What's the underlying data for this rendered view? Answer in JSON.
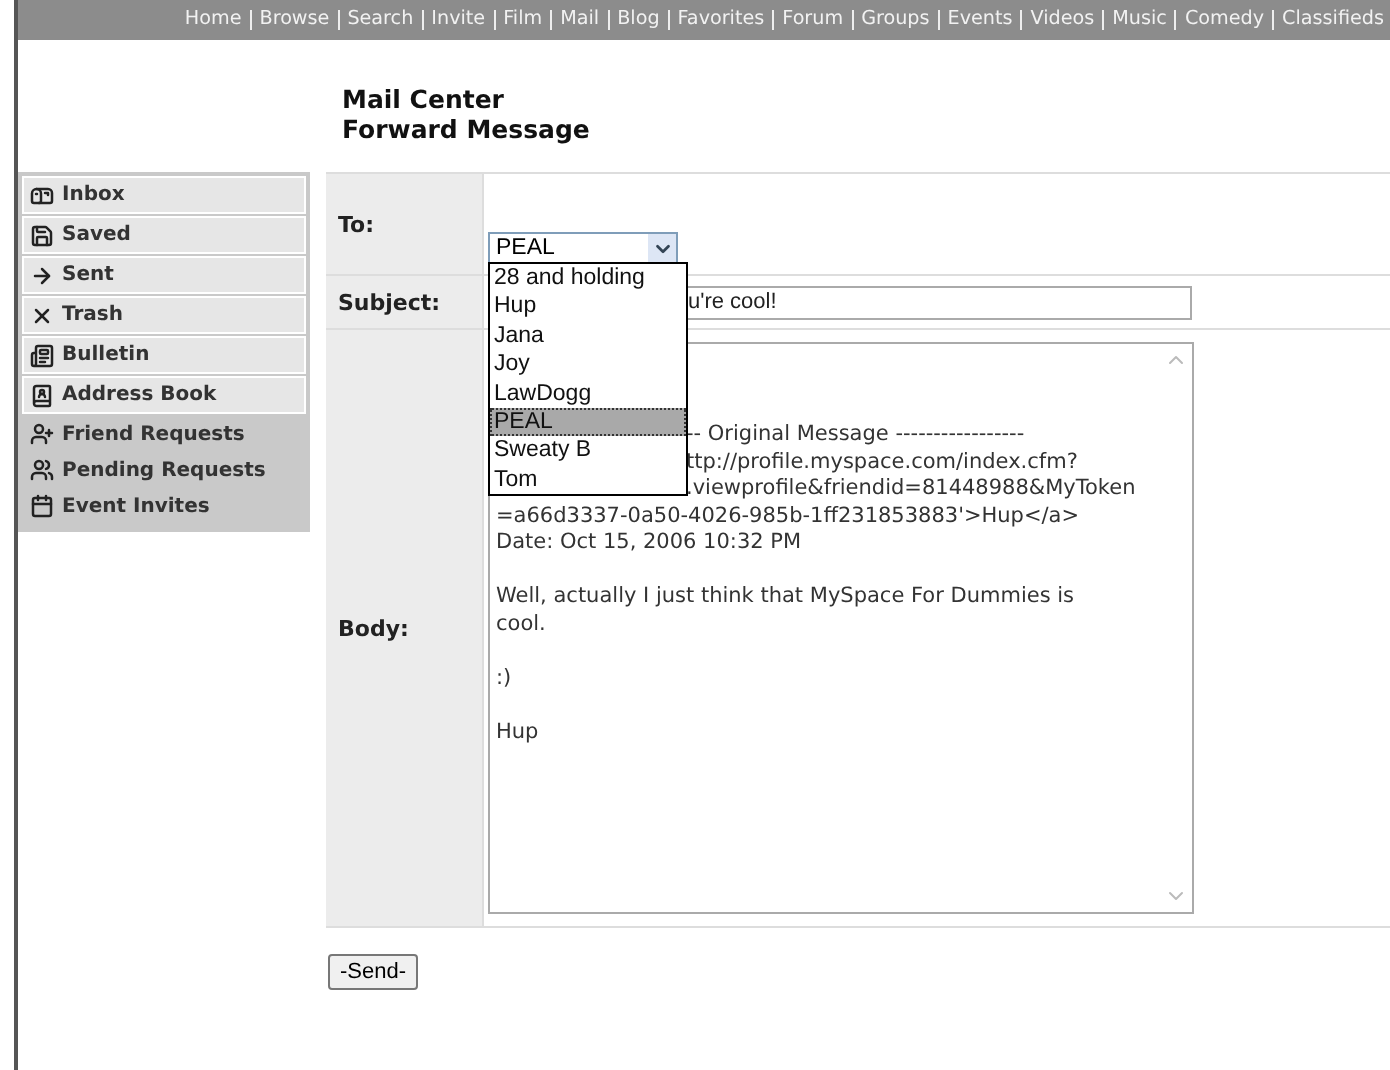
{
  "nav": [
    "Home",
    "Browse",
    "Search",
    "Invite",
    "Film",
    "Mail",
    "Blog",
    "Favorites",
    "Forum",
    "Groups",
    "Events",
    "Videos",
    "Music",
    "Comedy",
    "Classifieds"
  ],
  "heading": [
    "Mail Center",
    "Forward Message"
  ],
  "sidebar": [
    {
      "label": "Inbox",
      "kind": "box"
    },
    {
      "label": "Saved",
      "kind": "box"
    },
    {
      "label": "Sent",
      "kind": "box"
    },
    {
      "label": "Trash",
      "kind": "box"
    },
    {
      "label": "Bulletin",
      "kind": "box"
    },
    {
      "label": "Address Book",
      "kind": "box"
    },
    {
      "label": "Friend Requests",
      "kind": "plain"
    },
    {
      "label": "Pending Requests",
      "kind": "plain"
    },
    {
      "label": "Event Invites",
      "kind": "plain"
    }
  ],
  "form": {
    "to_label": "To:",
    "to_value": "PEAL",
    "subject_label": "Subject:",
    "subject_value": "u're cool!",
    "body_label": "Body:",
    "body_paragraphs": [
      {
        "partly_hidden_lines": [
          "-- Original Message -----------------",
          "ttp://profile.myspace.com/index.cfm?",
          ".viewprofile&friendid=81448988&MyToken"
        ],
        "lines": [
          "=a66d3337-0a50-4026-985b-1ff231853883'>Hup</a>",
          "Date: Oct 15, 2006 10:32 PM"
        ]
      },
      {
        "lines": [
          "Well, actually I just think that MySpace For Dummies is cool."
        ]
      },
      {
        "lines": [
          ":)"
        ]
      },
      {
        "lines": [
          "Hup"
        ]
      }
    ]
  },
  "dropdown_options": [
    {
      "label": "28 and holding",
      "selected": false
    },
    {
      "label": "Hup",
      "selected": false
    },
    {
      "label": "Jana",
      "selected": false
    },
    {
      "label": "Joy",
      "selected": false
    },
    {
      "label": "LawDogg",
      "selected": false
    },
    {
      "label": "PEAL",
      "selected": true
    },
    {
      "label": "Sweaty B",
      "selected": false
    },
    {
      "label": "Tom",
      "selected": false
    }
  ],
  "send_button": "-Send-"
}
